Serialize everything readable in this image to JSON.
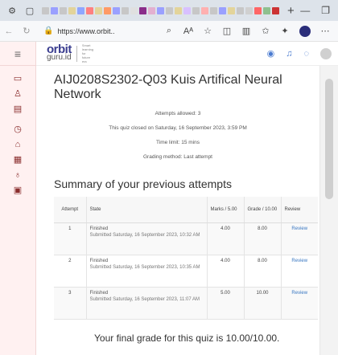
{
  "browser": {
    "tab_colors": [
      "#c7c7c7",
      "#9aa0ff",
      "#c7c7c7",
      "#e3d49a",
      "#8fa6ff",
      "#ff8080",
      "#e3d49a",
      "#ff9a66",
      "#9aa0ff",
      "#c7c7c7",
      "#e0e0e0",
      "#8a2d8a",
      "#e3b0d0",
      "#9aa0ff",
      "#c7c7c7",
      "#e3d49a",
      "#d8c0ff",
      "#c7c7c7",
      "#ffb0b0",
      "#c7c7c7",
      "#9aa0ff",
      "#e3d49a",
      "#c7c7c7",
      "#d0d0d0",
      "#ff6666",
      "#8fc08f",
      "#cc3333"
    ],
    "url_text": "https://www.orbit..",
    "icons": [
      "settings-icon",
      "tab-actions-icon",
      "back-icon",
      "refresh-icon",
      "lock-icon",
      "search-icon",
      "reader-icon",
      "favorite-icon",
      "extensions-icon",
      "split-screen-icon",
      "favorites-bar-icon",
      "profile-icon",
      "more-icon"
    ]
  },
  "sidebar": {
    "icons": [
      "menu-icon",
      "folder-icon",
      "user-icon",
      "book-icon",
      "time-icon",
      "home-icon",
      "grid-icon",
      "graduation-icon",
      "calendar-icon"
    ]
  },
  "header": {
    "brand_top": "orbit",
    "brand_bottom": "guru.id",
    "tagline": "Smart learning for future era"
  },
  "quiz": {
    "title": "AIJ0208S2302-Q03 Kuis Artifical Neural Network",
    "attempts_allowed": "Attempts allowed: 3",
    "closed_on": "This quiz closed on Saturday, 16 September 2023, 3:59 PM",
    "time_limit": "Time limit: 15 mins",
    "grading_method": "Grading method: Last attempt",
    "summary_heading": "Summary of your previous attempts",
    "columns": {
      "attempt": "Attempt",
      "state": "State",
      "marks": "Marks / 5.00",
      "grade": "Grade / 10.00",
      "review": "Review"
    },
    "attempts": [
      {
        "attempt": "1",
        "state": "Finished",
        "submitted": "Submitted Saturday, 16 September 2023, 10:32 AM",
        "marks": "4.00",
        "grade": "8.00",
        "review": "Review"
      },
      {
        "attempt": "2",
        "state": "Finished",
        "submitted": "Submitted Saturday, 16 September 2023, 10:35 AM",
        "marks": "4.00",
        "grade": "8.00",
        "review": "Review"
      },
      {
        "attempt": "3",
        "state": "Finished",
        "submitted": "Submitted Saturday, 16 September 2023, 11:07 AM",
        "marks": "5.00",
        "grade": "10.00",
        "review": "Review"
      }
    ],
    "final_grade": "Your final grade for this quiz is 10.00/10.00."
  }
}
